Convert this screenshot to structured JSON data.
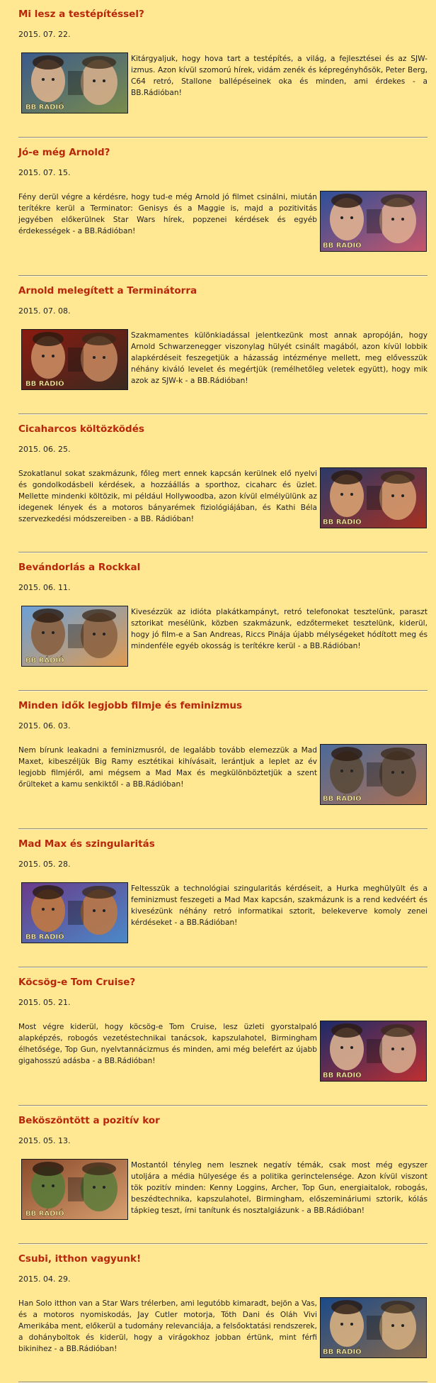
{
  "branding": {
    "radio_logo": "BB RÁDIÓ"
  },
  "posts": [
    {
      "title": "Mi lesz a testépítéssel?",
      "date": "2015. 07. 22.",
      "text": "Kitárgyaljuk, hogy hova tart a testépítés, a világ, a fejlesztései és az SJW-izmus. Azon kívül szomorú hírek, vidám zenék és képregényhősök, Peter Berg, C64 retró, Stallone ballépéseinek oka és minden, ami érdekes - a BB.Rádióban!",
      "image_side": "left",
      "thumb_colors": [
        "#3b5a8c",
        "#7a8c4a",
        "#d9b08c"
      ]
    },
    {
      "title": "Jó-e még Arnold?",
      "date": "2015. 07. 15.",
      "text": "Fény derül végre a kérdésre, hogy tud-e még Arnold jó filmet csinálni, miután terítékre kerül a Terminator: Genisys és a Maggie is, majd a pozitivitás jegyében előkerülnek Star Wars hírek, popzenei kérdések és egyéb érdekességek - a BB.Rádióban!",
      "image_side": "right",
      "thumb_colors": [
        "#2a4f9a",
        "#c9566a",
        "#e0b090"
      ]
    },
    {
      "title": "Arnold melegített a Terminátorra",
      "date": "2015. 07. 08.",
      "text": "Szakmamentes különkiadással jelentkezünk most annak apropóján, hogy Arnold Schwarzenegger viszonylag hülyét csinált magából, azon kívül lobbik alapkérdéseit feszegetjük a házasság intézménye mellett, meg elővesszük néhány kiváló levelet és megértjük (remélhetőleg veletek együtt), hogy mik azok az SJW-k - a BB.Rádióban!",
      "image_side": "left",
      "thumb_colors": [
        "#8a1a10",
        "#3a2a20",
        "#c88a60"
      ]
    },
    {
      "title": "Cicaharcos költözködés",
      "date": "2015. 06. 25.",
      "text": "Szokatlanul sokat szakmázunk, főleg mert ennek kapcsán kerülnek elő nyelvi és gondolkodásbeli kérdések, a hozzáállás a sporthoz, cicaharc és üzlet. Mellette mindenki költözik, mi például Hollywoodba, azon kívül elmélyülünk az idegenek lények és a motoros bányarémek fiziológiájában, és Kathi Béla szervezkedési módszereiben - a BB. Rádióban!",
      "image_side": "right",
      "thumb_colors": [
        "#2a3a6a",
        "#a83020",
        "#d8a070"
      ]
    },
    {
      "title": "Bevándorlás a Rockkal",
      "date": "2015. 06. 11.",
      "text": "Kivesézzük az idióta plakátkampányt, retró telefonokat tesztelünk, paraszt sztorikat mesélünk, közben szakmázunk, edzőtermeket tesztelünk, kiderül, hogy jó film-e a San Andreas, Riccs Pinája újabb mélységeket hódított meg és mindenféle egyéb okosság is terítékre kerül - a BB.Rádióban!",
      "image_side": "left",
      "thumb_colors": [
        "#6aa0d8",
        "#e09a50",
        "#8a6040"
      ]
    },
    {
      "title": "Minden idők legjobb filmje és feminizmus",
      "date": "2015. 06. 03.",
      "text": "Nem bírunk leakadni a feminizmusról, de legalább tovább elemezzük a Mad Maxet, kibeszéljük Big Ramy esztétikai kihívásait, lerántjuk a leplet az év legjobb filmjéről, ami mégsem a Mad Max és megkülönböztetjük a szent őrülteket a kamu senkiktől - a BB.Rádióban!",
      "image_side": "right",
      "thumb_colors": [
        "#4a6a9a",
        "#b07050",
        "#5a4a3a"
      ]
    },
    {
      "title": "Mad Max és szingularitás",
      "date": "2015. 05. 28.",
      "text": "Feltesszük a technológiai szingularitás kérdéseit, a Hurka meghülyült és a feminizmust feszegeti a Mad Max kapcsán, szakmázunk is a rend kedvéért és kivesézünk néhány retró informatikai sztorit, belekeverve komoly zenei kérdéseket - a BB.Rádióban!",
      "image_side": "left",
      "thumb_colors": [
        "#6a3a8a",
        "#4a8ac8",
        "#c07840"
      ]
    },
    {
      "title": "Köcsög-e Tom Cruise?",
      "date": "2015. 05. 21.",
      "text": "Most végre kiderül, hogy köcsög-e Tom Cruise, lesz üzleti gyorstalpaló alapképzés, robogós vezetéstechnikai tanácsok, kapszulahotel, Birmingham élhetősége, Top Gun, nyelvtannácizmus és minden, ami még belefért az újabb gigahosszú adásba - a BB.Rádióban!",
      "image_side": "right",
      "thumb_colors": [
        "#1a2a6a",
        "#c03030",
        "#d8b090"
      ]
    },
    {
      "title": "Beköszöntött a pozitív kor",
      "date": "2015. 05. 13.",
      "text": "Mostantól tényleg nem lesznek negatív témák, csak most még egyszer utoljára a média hülyesége és a politika gerinctelensége. Azon kívül viszont tök pozitív minden: Kenny Loggins, Archer, Top Gun, energiaitalok, robogás, beszédtechnika, kapszulahotel, Birmingham, előszemináriumi sztorik, kólás tápkieg teszt, írni tanítunk és nosztalgiázunk - a BB.Rádióban!",
      "image_side": "left",
      "thumb_colors": [
        "#8a4a2a",
        "#d8a070",
        "#5a7a3a"
      ]
    },
    {
      "title": "Csubi, itthon vagyunk!",
      "date": "2015. 04. 29.",
      "text": "Han Solo itthon van a Star Wars trélerben, ami legutóbb kimaradt, bejön a Vas, és a motoros nyomiskodás, Jay Cutler motorja, Tóth Dani és Oláh Vivi Amerikába ment, előkerül a tudomány relevanciája, a felsőoktatási rendszerek, a dohányboltok és kiderül, hogy a virágokhoz jobban értünk, mint férfi bikinihez - a BB.Rádióban!",
      "image_side": "right",
      "thumb_colors": [
        "#1a4a8a",
        "#8a6a4a",
        "#d8b080"
      ]
    }
  ]
}
